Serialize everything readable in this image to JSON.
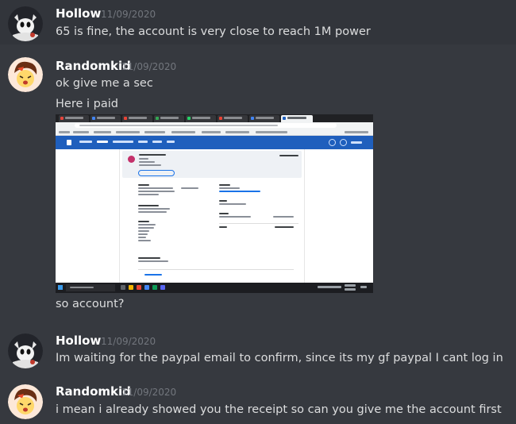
{
  "messages": [
    {
      "username": "Hollow",
      "timestamp": "11/09/2020",
      "lines": [
        "65 is fine, the account is very close to reach 1M power"
      ]
    },
    {
      "username": "Randomkid",
      "timestamp": "11/09/2020",
      "lines": [
        "ok give me a sec",
        "Here i paid"
      ]
    },
    {
      "username": "",
      "timestamp": "",
      "lines": [
        "so account?"
      ]
    },
    {
      "username": "Hollow",
      "timestamp": "11/09/2020",
      "lines": [
        "Im waiting for the paypal email to confirm, since its my gf paypal I cant log in"
      ]
    },
    {
      "username": "Randomkid",
      "timestamp": "11/09/2020",
      "lines": [
        "i mean  i already showed you the receipt so can you give me the account first"
      ]
    }
  ],
  "attachment": {
    "kind": "image",
    "depicts": "browser-screenshot"
  },
  "colors": {
    "background": "#36393f",
    "username": "#ffffff",
    "timestamp": "#72767d",
    "text": "#dcddde",
    "paypal": "#1f5fbd"
  }
}
